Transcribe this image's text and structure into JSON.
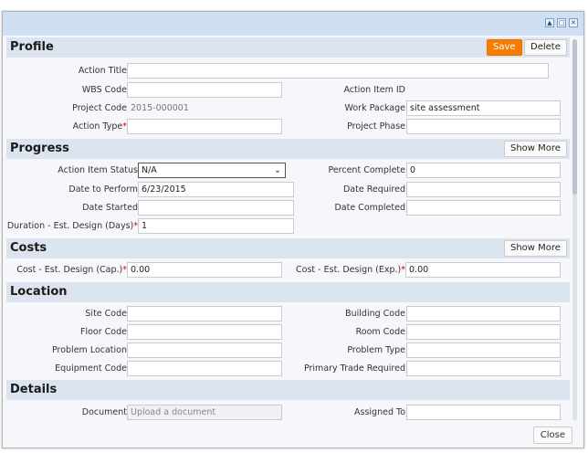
{
  "window": {
    "controls": [
      "collapse-icon",
      "maximize-icon",
      "close-icon"
    ]
  },
  "profile": {
    "title": "Profile",
    "save": "Save",
    "delete": "Delete",
    "action_title": "Action Title",
    "wbs_code": "WBS Code",
    "action_item_id": "Action Item ID",
    "project_code": "Project Code",
    "project_code_value": "2015-000001",
    "work_package": "Work Package",
    "work_package_value": "site assessment",
    "action_type": "Action Type",
    "project_phase": "Project Phase"
  },
  "progress": {
    "title": "Progress",
    "show_more": "Show More",
    "status": "Action Item Status",
    "status_value": "N/A",
    "percent": "Percent Complete",
    "percent_value": "0",
    "date_perform": "Date to Perform",
    "date_perform_value": "6/23/2015",
    "date_required": "Date Required",
    "date_started": "Date Started",
    "date_completed": "Date Completed",
    "duration": "Duration - Est. Design (Days)",
    "duration_value": "1"
  },
  "costs": {
    "title": "Costs",
    "show_more": "Show More",
    "cap": "Cost - Est. Design (Cap.)",
    "cap_value": "0.00",
    "exp": "Cost - Est. Design (Exp.)",
    "exp_value": "0.00"
  },
  "location": {
    "title": "Location",
    "site": "Site Code",
    "building": "Building Code",
    "floor": "Floor Code",
    "room": "Room Code",
    "problem_location": "Problem Location",
    "problem_type": "Problem Type",
    "equipment": "Equipment Code",
    "trade": "Primary Trade Required"
  },
  "details": {
    "title": "Details",
    "document": "Document",
    "document_placeholder": "Upload a document",
    "assigned": "Assigned To"
  },
  "footer": {
    "close": "Close"
  },
  "required_mark": "*"
}
